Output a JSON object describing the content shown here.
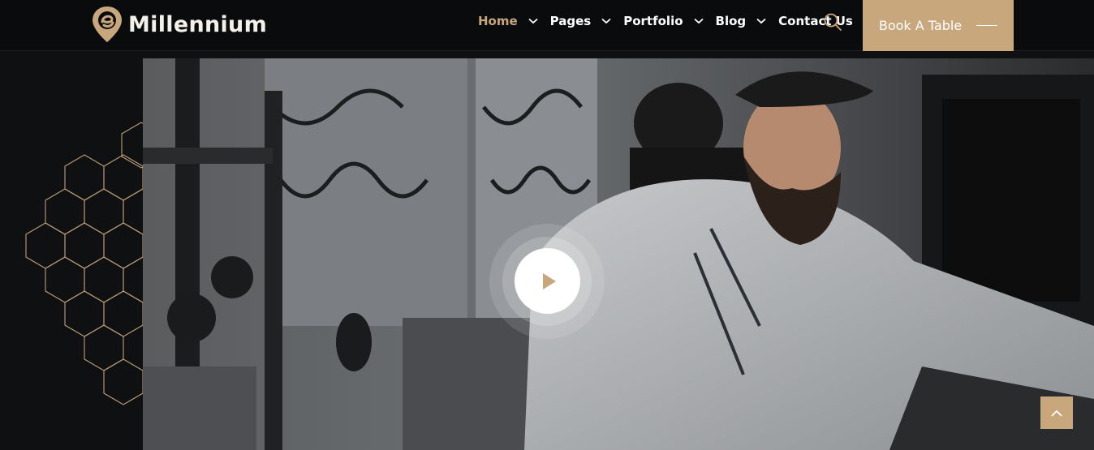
{
  "brand": {
    "name": "Millennium",
    "logo_icon": "pin-logo-icon"
  },
  "nav": {
    "items": [
      {
        "label": "Home",
        "active": true,
        "has_dropdown": true
      },
      {
        "label": "Pages",
        "active": false,
        "has_dropdown": true
      },
      {
        "label": "Portfolio",
        "active": false,
        "has_dropdown": true
      },
      {
        "label": "Blog",
        "active": false,
        "has_dropdown": true
      },
      {
        "label": "Contact Us",
        "active": false,
        "has_dropdown": false
      }
    ],
    "search_icon": "search-icon"
  },
  "cta": {
    "label": "Book A Table"
  },
  "hero": {
    "image": "chef-in-kitchen-photo",
    "play_icon": "play-icon",
    "decoration": "hexagon-pattern"
  },
  "scroll_top": {
    "icon": "chevron-up-icon"
  },
  "colors": {
    "accent": "#c9a77c",
    "header_bg": "#0a0b0d",
    "page_bg": "#0f1012",
    "nav_text": "#ffffff"
  }
}
